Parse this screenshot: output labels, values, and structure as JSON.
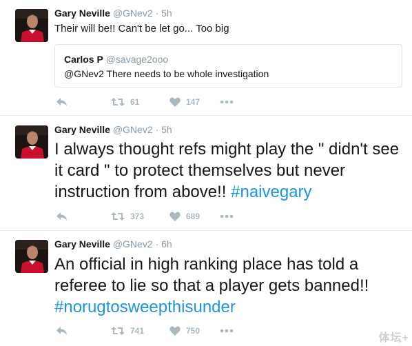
{
  "tweets": [
    {
      "name": "Gary Neville",
      "handle": "@GNev2",
      "separator": "·",
      "time": "5h",
      "text": "Their will be!! Can't be let go... Too big",
      "quote": {
        "name": "Carlos P",
        "handle": "@savage2ooo",
        "text": "@GNev2 There needs to be whole investigation"
      },
      "retweets": "61",
      "likes": "147"
    },
    {
      "name": "Gary Neville",
      "handle": "@GNev2",
      "separator": "·",
      "time": "5h",
      "text": "I always thought refs might play the \" didn't see it card \" to protect themselves but never instruction from above!!",
      "hashtag": "#naivegary",
      "retweets": "373",
      "likes": "689"
    },
    {
      "name": "Gary Neville",
      "handle": "@GNev2",
      "separator": "·",
      "time": "6h",
      "text": "An official in high ranking place has told a referee to lie so that a player gets banned!!",
      "hashtag": "#norugtosweepthisunder",
      "retweets": "741",
      "likes": "750"
    }
  ],
  "icons": {
    "reply": "reply-arrow",
    "retweet": "retweet-arrows",
    "like": "heart",
    "more": "ellipsis"
  },
  "colors": {
    "hashtag": "#1b95e0",
    "meta": "#8899a6",
    "action": "#aab8c2"
  },
  "watermark": "体坛+"
}
